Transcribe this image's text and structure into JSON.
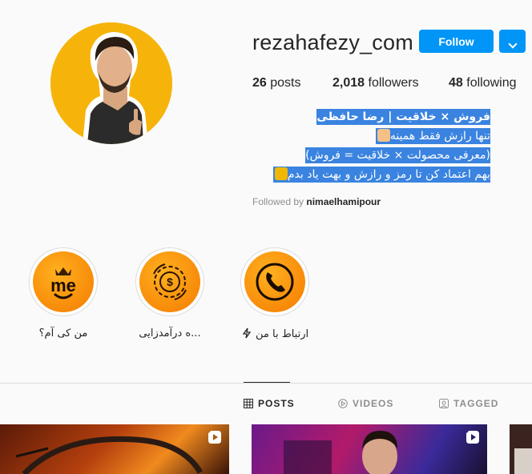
{
  "profile": {
    "username": "rezahafezy_com",
    "follow_label": "Follow",
    "stats": {
      "posts_count": "26",
      "posts_label": "posts",
      "followers_count": "2,018",
      "followers_label": "followers",
      "following_count": "48",
      "following_label": "following"
    },
    "bio": {
      "line1": "فروش × خلاقیت | رضا حافظی",
      "line2": "تنها رازش فقط همینه",
      "line3": "(معرفی محصولت × خلاقیت = فروش)",
      "line4": "بهم اعتماد کن تا رمز و رازش و بهت یاد بدم"
    },
    "followed_by_prefix": "Followed by",
    "followed_by_user": "nimaelhamipour"
  },
  "highlights": [
    {
      "label": "من کی آم؟",
      "icon": "me-crown-logo"
    },
    {
      "label": "...ه درآمدزایی",
      "icon": "money-gear-icon"
    },
    {
      "label": "ارتباط با من",
      "icon": "phone-icon"
    }
  ],
  "tabs": [
    {
      "label": "POSTS",
      "icon": "grid-icon",
      "active": true
    },
    {
      "label": "VIDEOS",
      "icon": "play-circle-icon",
      "active": false
    },
    {
      "label": "TAGGED",
      "icon": "tag-icon",
      "active": false
    }
  ],
  "colors": {
    "accent": "#0095f6",
    "highlight_orange": "#f47b00",
    "selection_blue": "#3a83e0"
  }
}
